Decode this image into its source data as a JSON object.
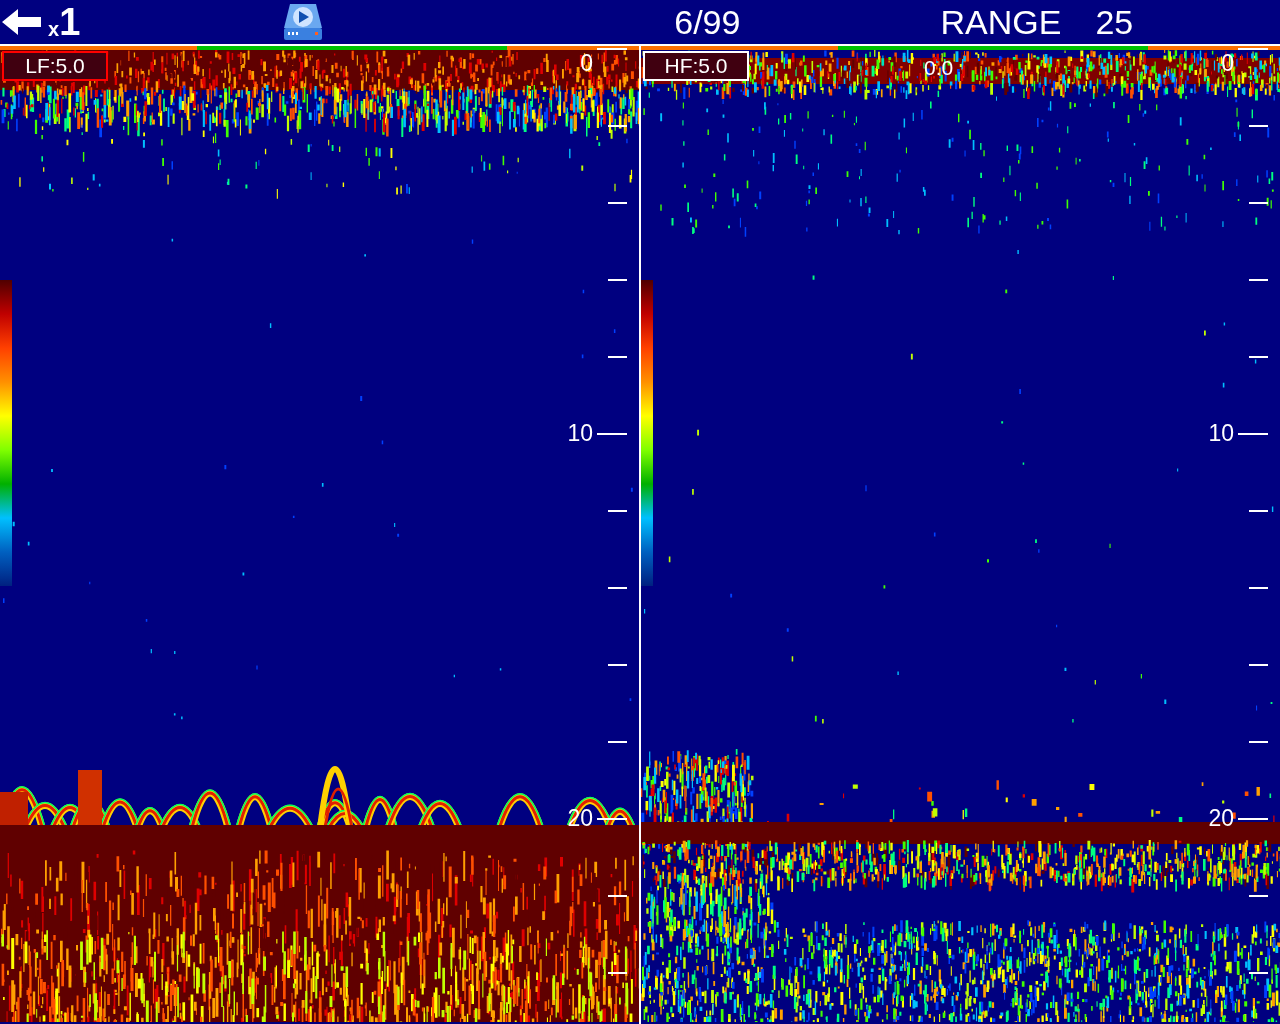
{
  "header": {
    "zoom_prefix": "x",
    "zoom_value": "1",
    "file_counter": "6/99",
    "range_label": "RANGE",
    "range_value": "25"
  },
  "panels": [
    {
      "kind": "lf",
      "label": "LF:5.0",
      "selected": true,
      "depth_labels": [
        "0",
        "10",
        "20"
      ]
    },
    {
      "kind": "hf",
      "label": "HF:5.0",
      "selected": false,
      "readout": "0.0",
      "depth_labels": [
        "0",
        "10",
        "20"
      ]
    }
  ]
}
